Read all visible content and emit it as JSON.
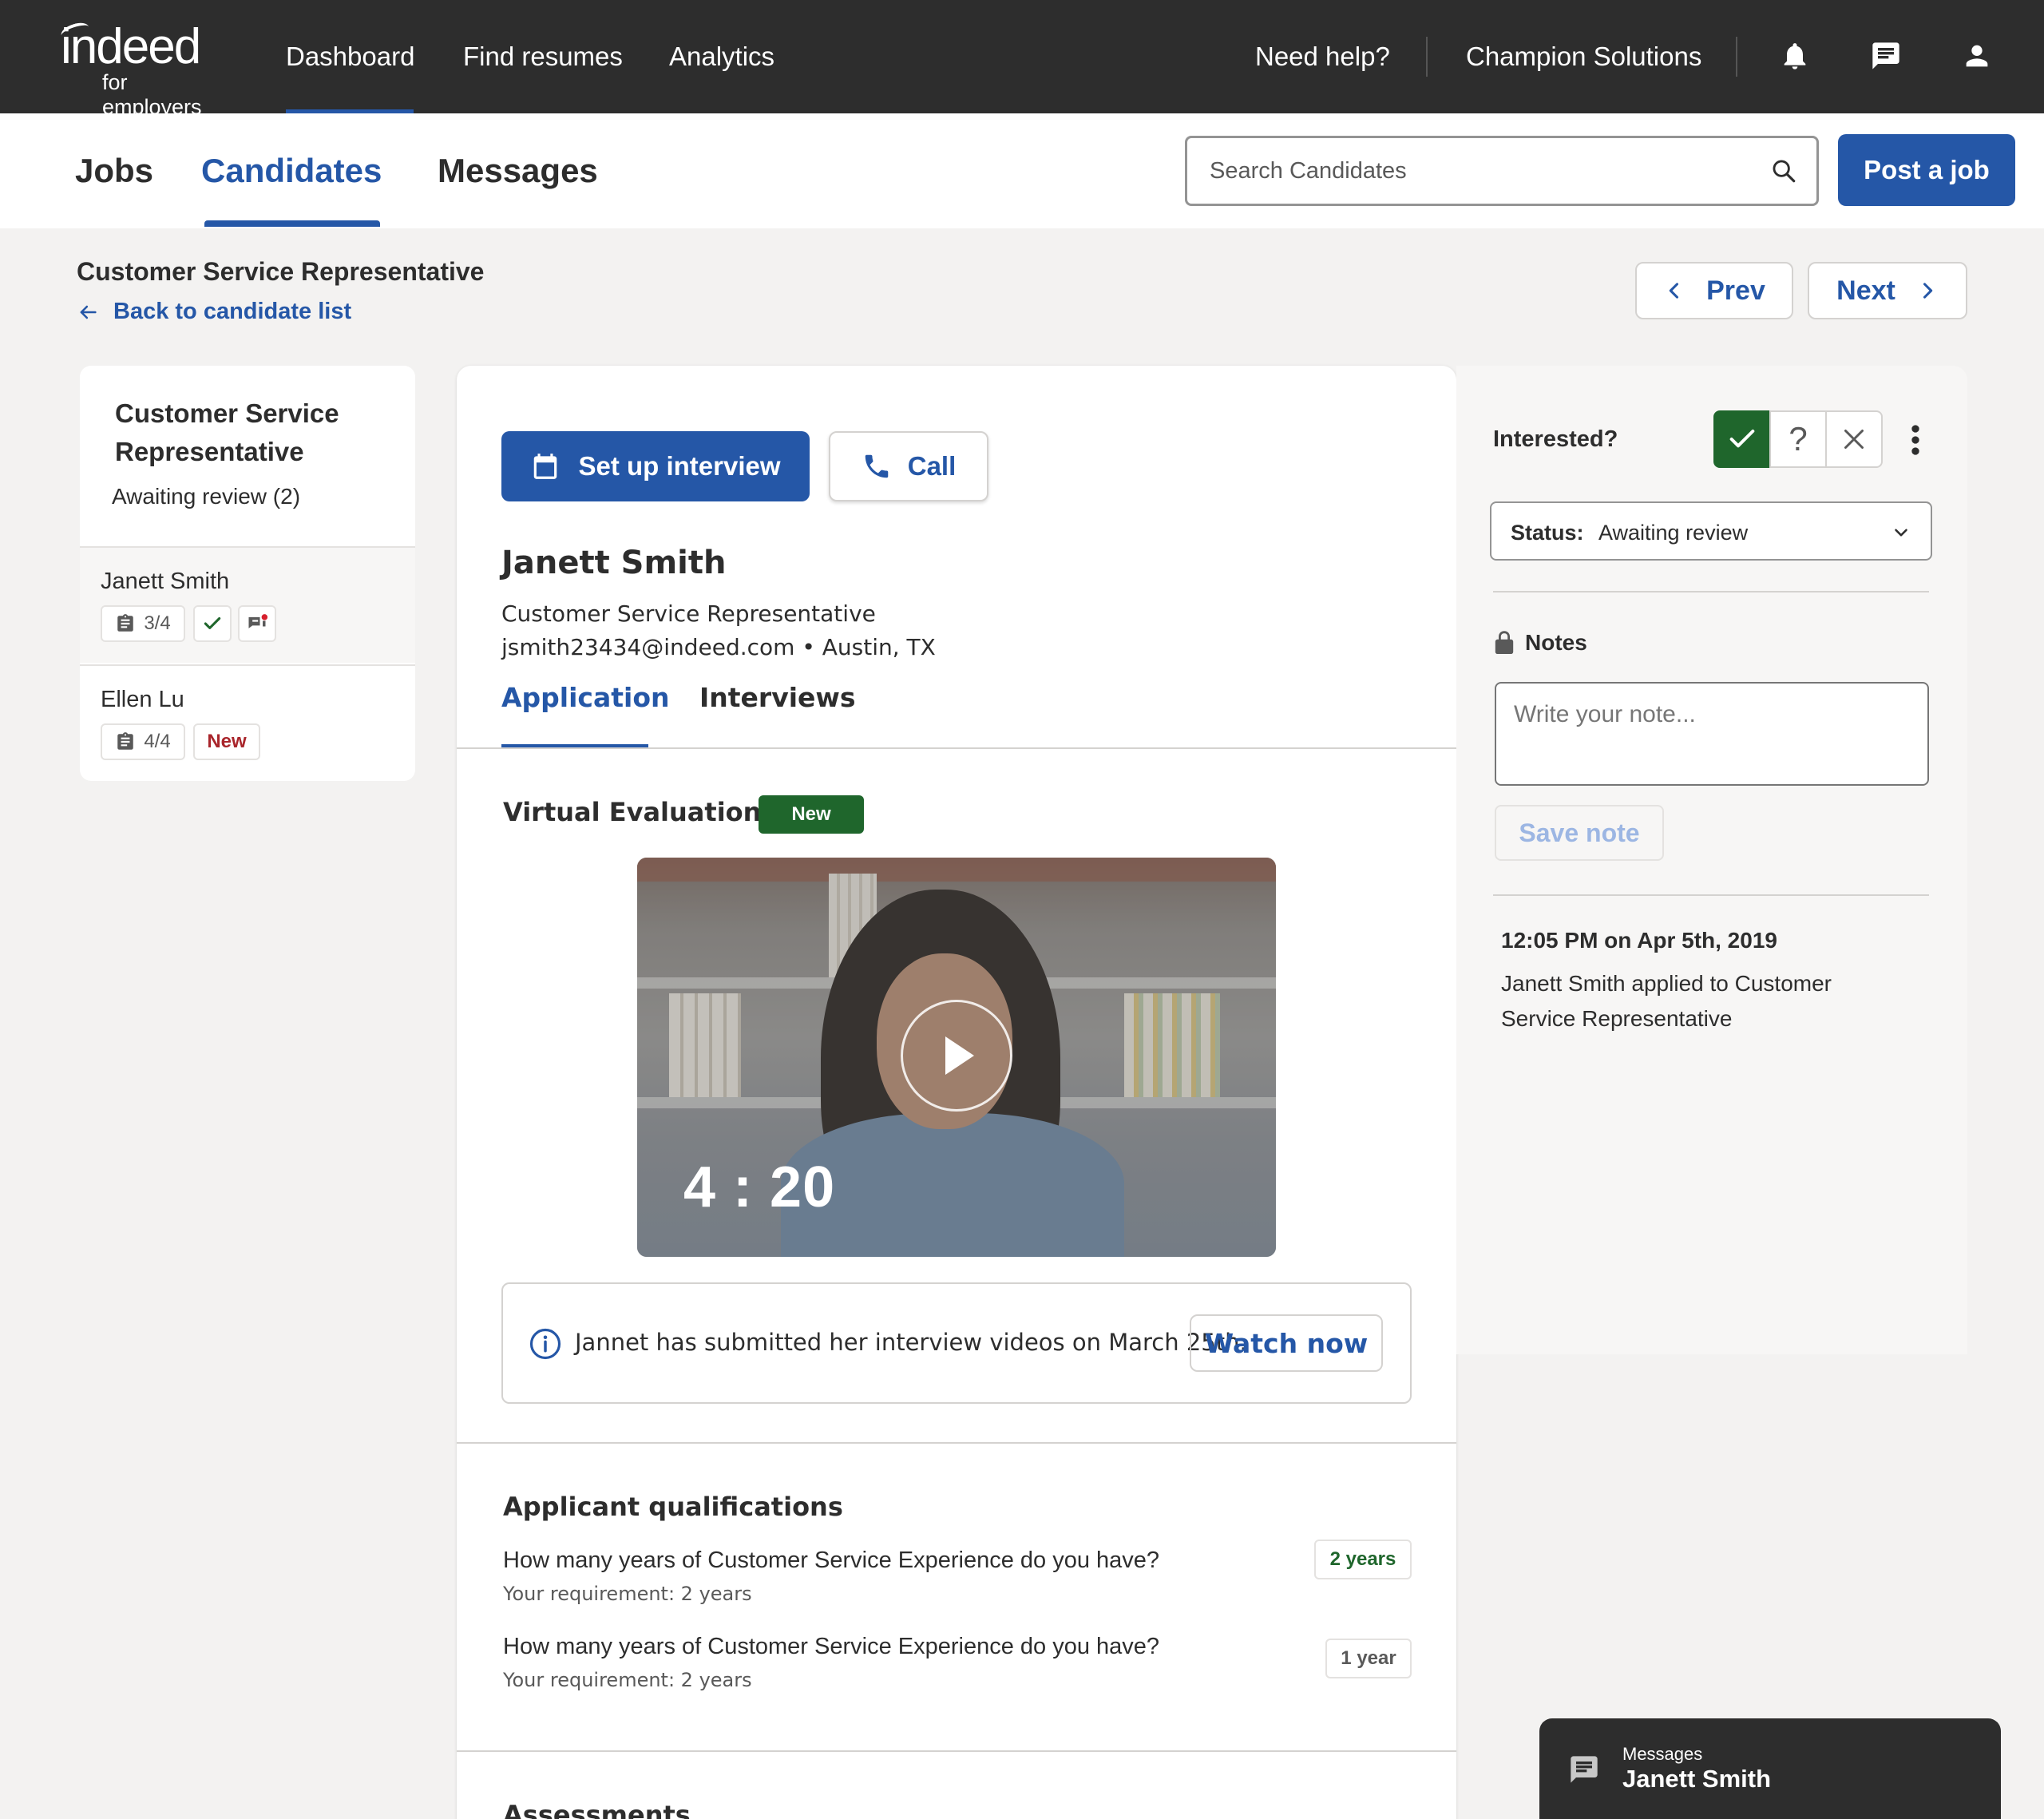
{
  "topnav": {
    "logo_word": "indeed",
    "logo_sub": "for employers",
    "items": [
      "Dashboard",
      "Find resumes",
      "Analytics"
    ],
    "help": "Need help?",
    "company": "Champion Solutions"
  },
  "subnav": {
    "tabs": [
      "Jobs",
      "Candidates",
      "Messages"
    ],
    "search_placeholder": "Search Candidates",
    "post_job": "Post a job"
  },
  "page": {
    "job_title": "Customer Service Representative",
    "back_link": "Back to candidate list",
    "prev": "Prev",
    "next": "Next"
  },
  "left_panel": {
    "title": "Customer Service Representative",
    "subtitle": "Awaiting review (2)",
    "candidates": [
      {
        "name": "Janett Smith",
        "progress": "3/4"
      },
      {
        "name": "Ellen Lu",
        "progress": "4/4",
        "badge": "New"
      }
    ]
  },
  "candidate": {
    "setup_interview": "Set up interview",
    "call": "Call",
    "name": "Janett Smith",
    "role": "Customer Service Representative",
    "contact": "jsmith23434@indeed.com • Austin, TX",
    "tabs": [
      "Application",
      "Interviews"
    ]
  },
  "evaluations": {
    "title": "Virtual Evaluations",
    "badge": "New",
    "duration": "4 : 20",
    "info_text": "Jannet has submitted her interview videos on March 25th.",
    "watch_now": "Watch now"
  },
  "qualifications": {
    "title": "Applicant qualifications",
    "items": [
      {
        "question": "How many years of Customer Service Experience do you have?",
        "requirement": "Your requirement: 2 years",
        "answer": "2 years"
      },
      {
        "question": "How many years of Customer Service Experience do you have?",
        "requirement": "Your requirement: 2 years",
        "answer": "1 year"
      }
    ]
  },
  "assessments": {
    "title": "Assessments"
  },
  "right_panel": {
    "interested": "Interested?",
    "question_mark": "?",
    "status_label": "Status:",
    "status_value": "Awaiting review",
    "notes_title": "Notes",
    "notes_placeholder": "Write your note...",
    "save_note": "Save note",
    "activity_time": "12:05 PM on Apr 5th, 2019",
    "activity_text": "Janett Smith applied to Customer Service Representative"
  },
  "dock": {
    "label": "Messages",
    "name": "Janett Smith"
  },
  "colors": {
    "brand_blue": "#2557a7",
    "dark_bar": "#2d2d2d",
    "success_green": "#1f662c",
    "alert_red": "#a9252b"
  }
}
